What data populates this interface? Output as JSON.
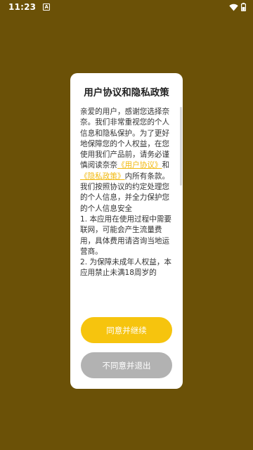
{
  "status_bar": {
    "time": "11:23",
    "notification_icon": "a-icon",
    "icons": [
      "wifi-icon",
      "battery-icon"
    ]
  },
  "dialog": {
    "title": "用户协议和隐私政策",
    "body": {
      "intro": "亲爱的用户，感谢您选择奈奈。我们非常重视您的个人信息和隐私保护。为了更好地保障您的个人权益，在您使用我们产品前，请务必谨慎阅读奈奈",
      "user_agreement_link": "《用户协议》",
      "and": "和",
      "privacy_policy_link": "《隐私政策》",
      "after_links": "内所有条款。我们按照协议的约定处理您的个人信息，并全力保护您的个人信息安全",
      "item_1": "1. 本应用在使用过程中需要联网，可能会产生流量费用，具体费用请咨询当地运营商。",
      "item_2": "2. 为保障未成年人权益，本应用禁止未满18周岁的"
    },
    "agree_button": "同意并继续",
    "disagree_button": "不同意并退出"
  },
  "colors": {
    "background": "#6b5107",
    "accent": "#f6c40e",
    "link": "#f1b80c",
    "disabled_button": "#b2b2b2"
  }
}
